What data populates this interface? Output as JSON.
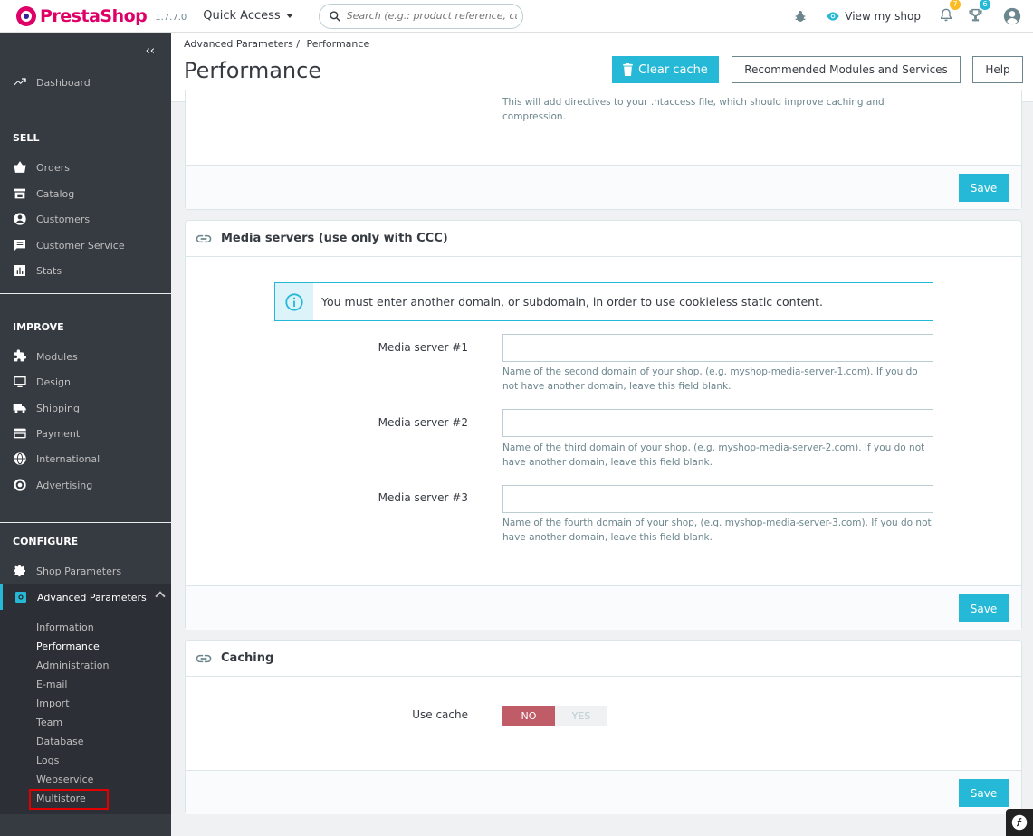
{
  "brand": {
    "name": "PrestaShop",
    "version": "1.7.7.0"
  },
  "topbar": {
    "quick_access": "Quick Access",
    "search_placeholder": "Search (e.g.: product reference, customer name…)",
    "view_shop": "View my shop",
    "notifications_count": "7",
    "orders_count": "6"
  },
  "sidebar": {
    "dashboard": "Dashboard",
    "sections": {
      "sell": "SELL",
      "improve": "IMPROVE",
      "configure": "CONFIGURE"
    },
    "sell_items": [
      "Orders",
      "Catalog",
      "Customers",
      "Customer Service",
      "Stats"
    ],
    "improve_items": [
      "Modules",
      "Design",
      "Shipping",
      "Payment",
      "International",
      "Advertising"
    ],
    "configure_items": [
      "Shop Parameters",
      "Advanced Parameters"
    ],
    "submenu": [
      "Information",
      "Performance",
      "Administration",
      "E-mail",
      "Import",
      "Team",
      "Database",
      "Logs",
      "Webservice",
      "Multistore"
    ]
  },
  "header": {
    "breadcrumb_parent": "Advanced Parameters",
    "breadcrumb_current": "Performance",
    "title": "Performance",
    "clear_cache": "Clear cache",
    "recommended": "Recommended Modules and Services",
    "help": "Help"
  },
  "panel_top": {
    "help_text": "This will add directives to your .htaccess file, which should improve caching and compression.",
    "save": "Save"
  },
  "media_servers": {
    "title": "Media servers (use only with CCC)",
    "alert": "You must enter another domain, or subdomain, in order to use cookieless static content.",
    "fields": [
      {
        "label": "Media server #1",
        "value": "",
        "help": "Name of the second domain of your shop, (e.g. myshop-media-server-1.com). If you do not have another domain, leave this field blank."
      },
      {
        "label": "Media server #2",
        "value": "",
        "help": "Name of the third domain of your shop, (e.g. myshop-media-server-2.com). If you do not have another domain, leave this field blank."
      },
      {
        "label": "Media server #3",
        "value": "",
        "help": "Name of the fourth domain of your shop, (e.g. myshop-media-server-3.com). If you do not have another domain, leave this field blank."
      }
    ],
    "save": "Save"
  },
  "caching": {
    "title": "Caching",
    "use_cache_label": "Use cache",
    "no": "NO",
    "yes": "YES",
    "save": "Save"
  },
  "colors": {
    "accent": "#25b9d7",
    "sidebar": "#363a41",
    "brand": "#df0067",
    "switch_no": "#c05c67"
  }
}
